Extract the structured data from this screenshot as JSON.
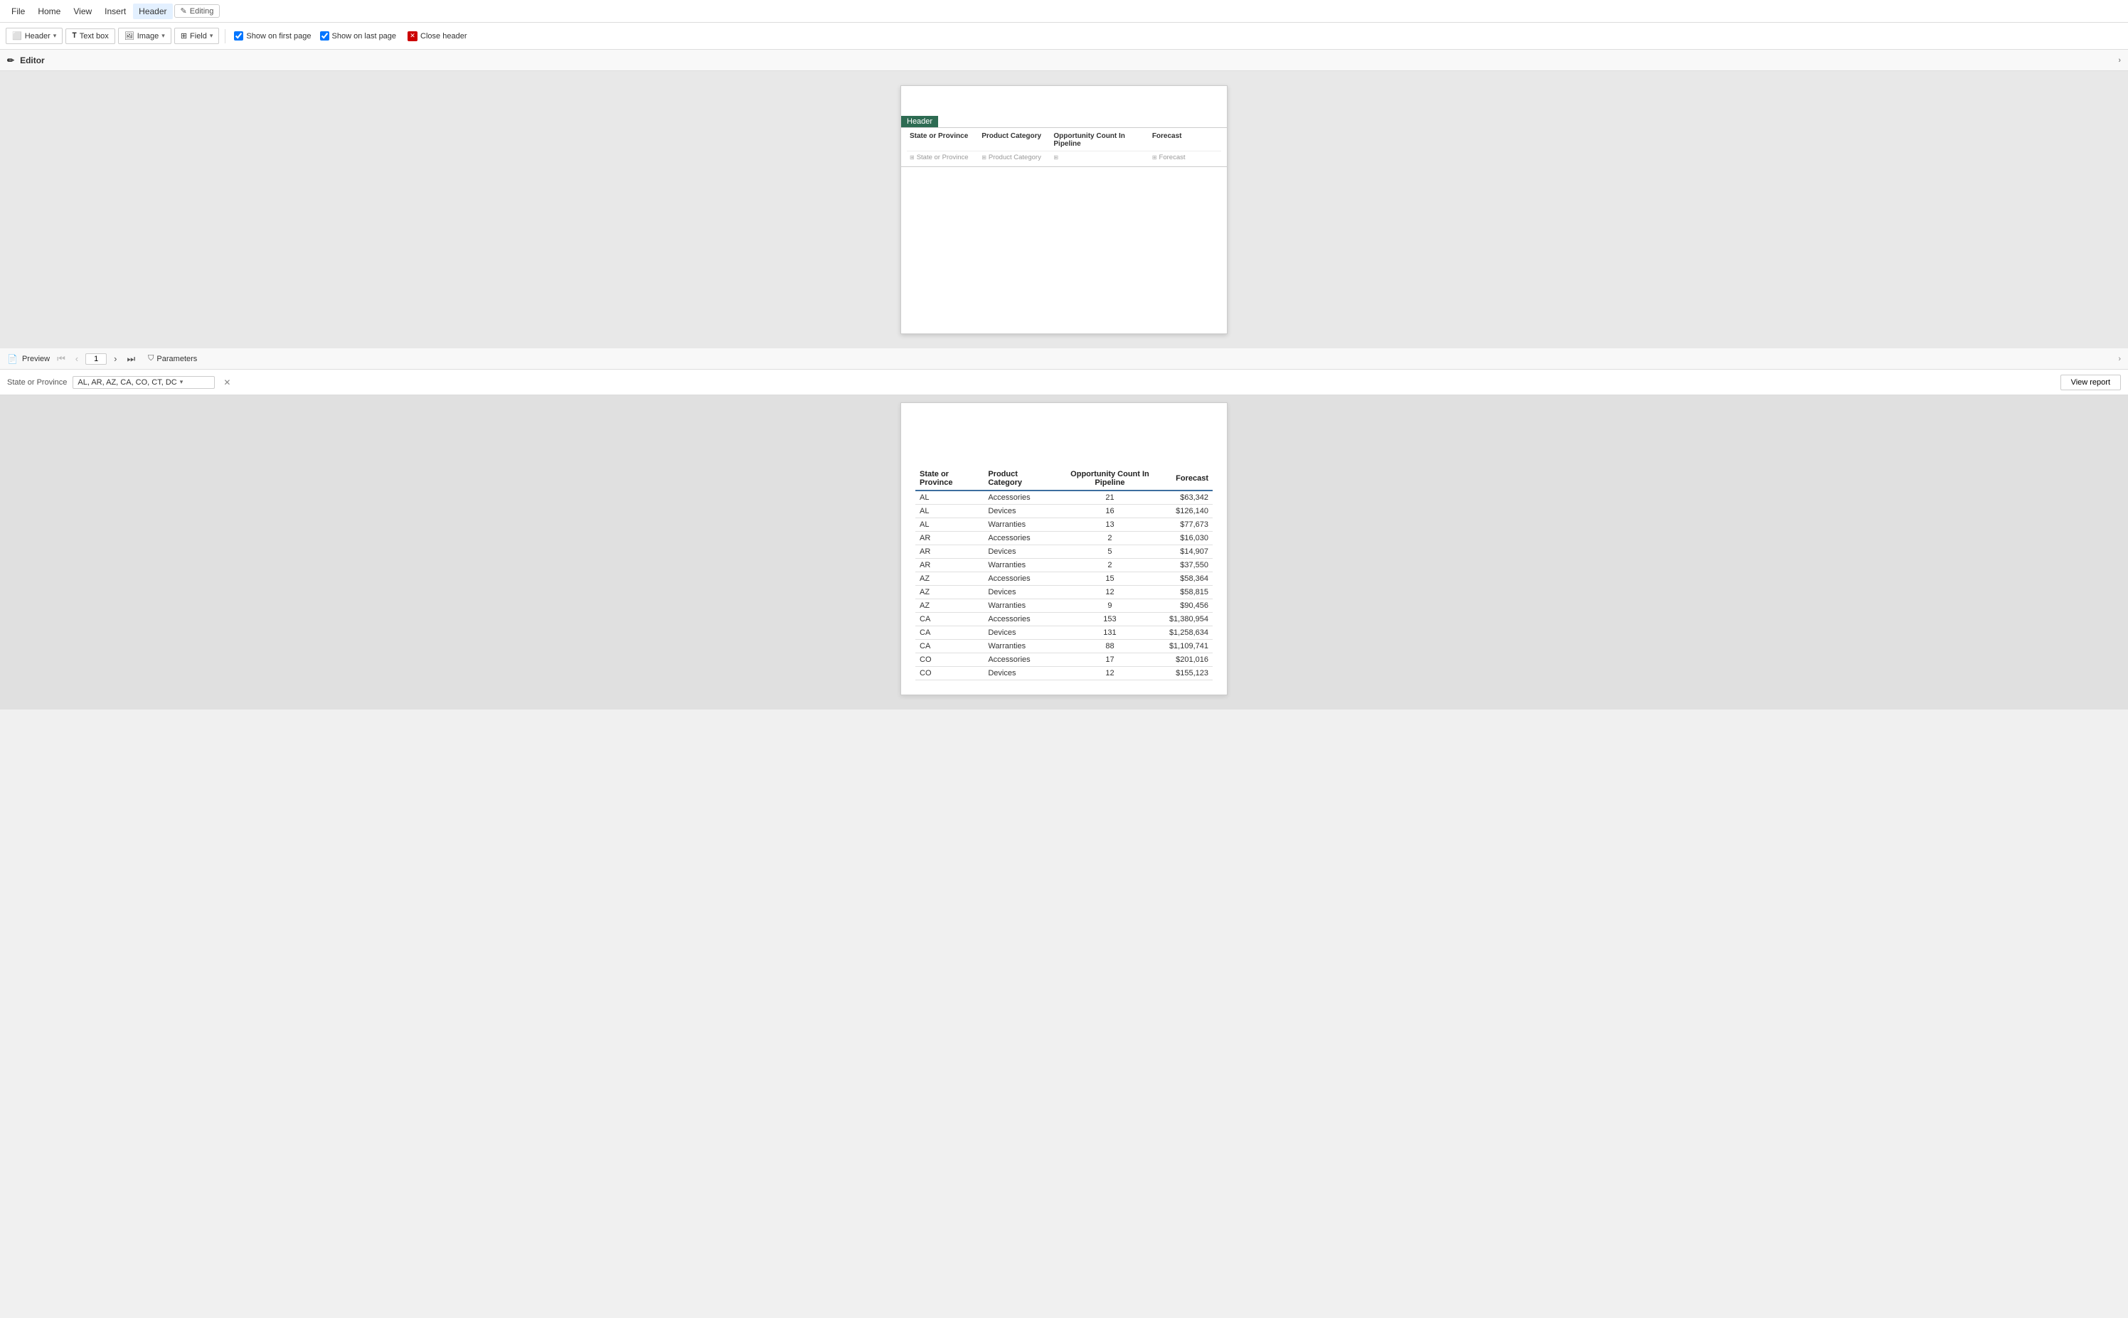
{
  "menubar": {
    "items": [
      "File",
      "Home",
      "View",
      "Insert"
    ],
    "active": "Header",
    "active_label": "Header",
    "editing_label": "Editing"
  },
  "toolbar": {
    "header_btn": "Header",
    "textbox_btn": "Text box",
    "image_btn": "Image",
    "field_btn": "Field",
    "show_first_label": "Show on first page",
    "show_last_label": "Show on last page",
    "close_header_label": "Close header"
  },
  "editor_section": {
    "label": "Editor"
  },
  "preview_section": {
    "label": "Preview"
  },
  "header_band": {
    "label": "Header"
  },
  "table": {
    "columns": [
      {
        "label": "State or Province"
      },
      {
        "label": "Product Category"
      },
      {
        "label": "Opportunity Count In Pipeline"
      },
      {
        "label": "Forecast"
      }
    ],
    "placeholder_rows": [
      [
        "State or Province",
        "Product Category",
        "",
        "Forecast"
      ]
    ]
  },
  "preview_nav": {
    "page_number": "1",
    "params_label": "Parameters"
  },
  "params_bar": {
    "label": "State or Province",
    "value": "AL, AR, AZ, CA, CO, CT, DC",
    "view_report": "View report"
  },
  "data_rows": [
    {
      "state": "AL",
      "category": "Accessories",
      "count": "21",
      "forecast": "$63,342"
    },
    {
      "state": "AL",
      "category": "Devices",
      "count": "16",
      "forecast": "$126,140"
    },
    {
      "state": "AL",
      "category": "Warranties",
      "count": "13",
      "forecast": "$77,673"
    },
    {
      "state": "AR",
      "category": "Accessories",
      "count": "2",
      "forecast": "$16,030"
    },
    {
      "state": "AR",
      "category": "Devices",
      "count": "5",
      "forecast": "$14,907"
    },
    {
      "state": "AR",
      "category": "Warranties",
      "count": "2",
      "forecast": "$37,550"
    },
    {
      "state": "AZ",
      "category": "Accessories",
      "count": "15",
      "forecast": "$58,364"
    },
    {
      "state": "AZ",
      "category": "Devices",
      "count": "12",
      "forecast": "$58,815"
    },
    {
      "state": "AZ",
      "category": "Warranties",
      "count": "9",
      "forecast": "$90,456"
    },
    {
      "state": "CA",
      "category": "Accessories",
      "count": "153",
      "forecast": "$1,380,954"
    },
    {
      "state": "CA",
      "category": "Devices",
      "count": "131",
      "forecast": "$1,258,634"
    },
    {
      "state": "CA",
      "category": "Warranties",
      "count": "88",
      "forecast": "$1,109,741"
    },
    {
      "state": "CO",
      "category": "Accessories",
      "count": "17",
      "forecast": "$201,016"
    },
    {
      "state": "CO",
      "category": "Devices",
      "count": "12",
      "forecast": "$155,123"
    }
  ]
}
